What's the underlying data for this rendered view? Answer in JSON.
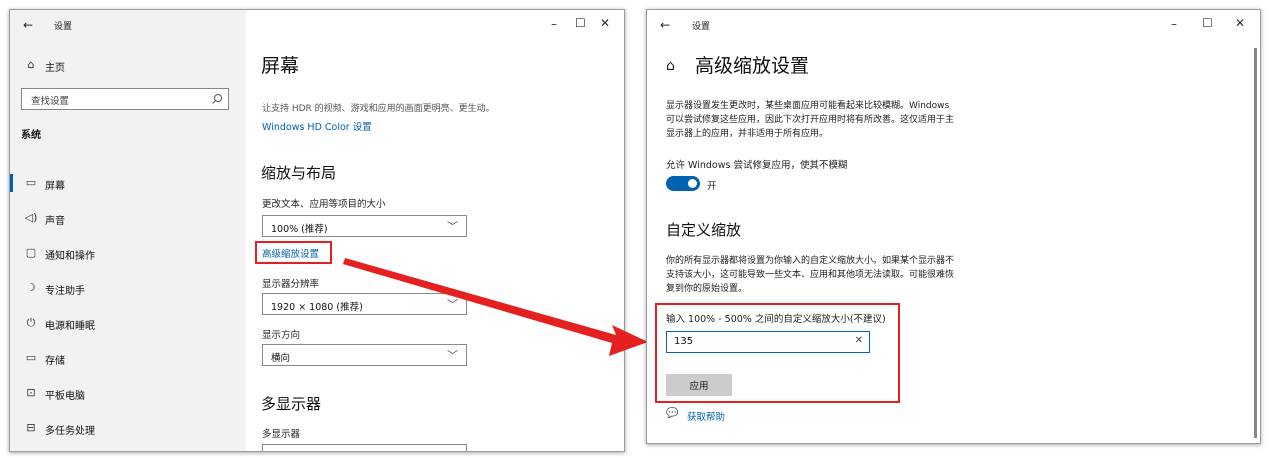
{
  "left_window": {
    "title": "设置",
    "back_glyph": "←",
    "controls": [
      "–",
      "☐",
      "✕"
    ],
    "sidebar": {
      "home_label": "主页",
      "search_placeholder": "查找设置",
      "section_label": "系统",
      "items": [
        {
          "icon": "monitor-icon",
          "glyph": "▭",
          "label": "屏幕",
          "selected": true
        },
        {
          "icon": "speaker-icon",
          "glyph": "◁)",
          "label": "声音"
        },
        {
          "icon": "notification-icon",
          "glyph": "▢",
          "label": "通知和操作"
        },
        {
          "icon": "focus-assist-icon",
          "glyph": "☽",
          "label": "专注助手"
        },
        {
          "icon": "power-icon",
          "glyph": "⏻",
          "label": "电源和睡眠"
        },
        {
          "icon": "storage-icon",
          "glyph": "▭",
          "label": "存储"
        },
        {
          "icon": "tablet-icon",
          "glyph": "⊡",
          "label": "平板电脑"
        },
        {
          "icon": "multitasking-icon",
          "glyph": "⊟",
          "label": "多任务处理"
        }
      ]
    },
    "main": {
      "page_title": "屏幕",
      "hdr_desc": "让支持 HDR 的视频、游戏和应用的画面更明亮、更生动。",
      "hdr_link": "Windows HD Color 设置",
      "scale_heading": "缩放与布局",
      "scale_label": "更改文本、应用等项目的大小",
      "scale_value": "100% (推荐)",
      "advanced_scaling_link": "高级缩放设置",
      "resolution_label": "显示器分辨率",
      "resolution_value": "1920 × 1080 (推荐)",
      "orientation_label": "显示方向",
      "orientation_value": "横向",
      "multi_heading": "多显示器",
      "multi_label": "多显示器"
    }
  },
  "right_window": {
    "title": "设置",
    "back_glyph": "←",
    "controls": [
      "–",
      "☐",
      "✕"
    ],
    "page_title": "高级缩放设置",
    "fix_desc_lines": [
      "显示器设置发生更改时，某些桌面应用可能看起来比较模糊。Windows",
      "可以尝试修复这些应用，因此下次打开应用时将有所改善。这仅适用于主",
      "显示器上的应用，并非适用于所有应用。"
    ],
    "fix_toggle_label": "允许 Windows 尝试修复应用，使其不模糊",
    "fix_toggle_state": "开",
    "custom_heading": "自定义缩放",
    "custom_desc_lines": [
      "你的所有显示器都将设置为你输入的自定义缩放大小。如果某个显示器不",
      "支持该大小，这可能导致一些文本、应用和其他项无法读取。可能很难恢",
      "复到你的原始设置。"
    ],
    "custom_input_label": "输入 100% - 500% 之间的自定义缩放大小(不建议)",
    "custom_input_value": "135",
    "apply_label": "应用",
    "help_label": "获取帮助"
  },
  "colors": {
    "accent": "#0063b1",
    "highlight_border": "#e52020",
    "arrow": "#e52020"
  }
}
